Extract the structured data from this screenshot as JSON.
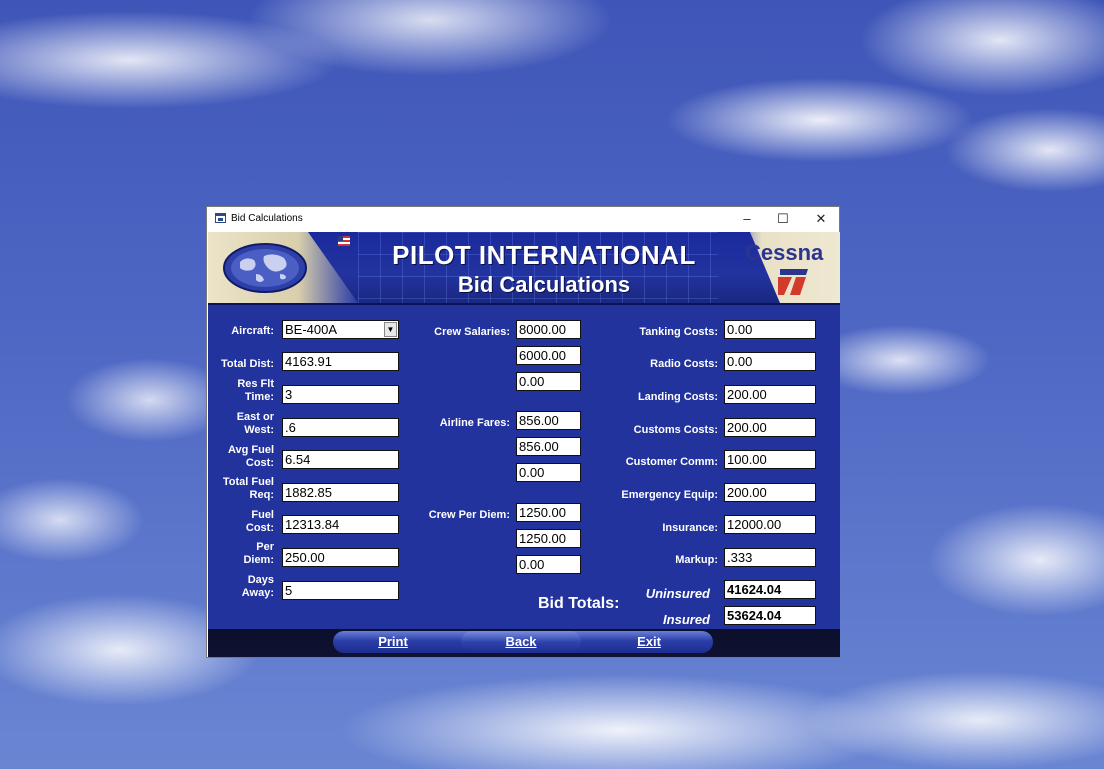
{
  "window": {
    "title": "Bid Calculations"
  },
  "banner": {
    "title": "PILOT INTERNATIONAL",
    "subtitle": "Bid Calculations",
    "brand": "Cessna"
  },
  "left": {
    "aircraft": {
      "label": "Aircraft:",
      "value": "BE-400A"
    },
    "total_dist": {
      "label": "Total Dist:",
      "value": "4163.91"
    },
    "res_flt_time": {
      "label_1": "Res Flt",
      "label_2": "Time:",
      "value": "3"
    },
    "east_west": {
      "label_1": "East or",
      "label_2": "West:",
      "value": ".6"
    },
    "avg_fuel_cost": {
      "label_1": "Avg Fuel",
      "label_2": "Cost:",
      "value": "6.54"
    },
    "total_fuel_req": {
      "label_1": "Total Fuel",
      "label_2": "Req:",
      "value": "1882.85"
    },
    "fuel_cost": {
      "label_1": "Fuel",
      "label_2": "Cost:",
      "value": "12313.84"
    },
    "per_diem": {
      "label_1": "Per",
      "label_2": "Diem:",
      "value": "250.00"
    },
    "days_away": {
      "label_1": "Days",
      "label_2": "Away:",
      "value": "5"
    }
  },
  "middle": {
    "crew_salaries": {
      "label": "Crew Salaries:",
      "values": [
        "8000.00",
        "6000.00",
        "0.00"
      ]
    },
    "airline_fares": {
      "label": "Airline Fares:",
      "values": [
        "856.00",
        "856.00",
        "0.00"
      ]
    },
    "crew_per_diem": {
      "label": "Crew Per Diem:",
      "values": [
        "1250.00",
        "1250.00",
        "0.00"
      ]
    },
    "bid_totals_label": "Bid Totals:"
  },
  "right": {
    "tanking_costs": {
      "label": "Tanking Costs:",
      "value": "0.00"
    },
    "radio_costs": {
      "label": "Radio Costs:",
      "value": "0.00"
    },
    "landing_costs": {
      "label": "Landing Costs:",
      "value": "200.00"
    },
    "customs_costs": {
      "label": "Customs Costs:",
      "value": "200.00"
    },
    "customer_comm": {
      "label": "Customer Comm:",
      "value": "100.00"
    },
    "emergency_equip": {
      "label": "Emergency Equip:",
      "value": "200.00"
    },
    "insurance": {
      "label": "Insurance:",
      "value": "12000.00"
    },
    "markup": {
      "label": "Markup:",
      "value": ".333"
    },
    "uninsured": {
      "label": "Uninsured",
      "value": "41624.04"
    },
    "insured": {
      "label": "Insured",
      "value": "53624.04"
    }
  },
  "footer": {
    "print": "Print",
    "back": "Back",
    "exit": "Exit"
  },
  "colors": {
    "form_bg": "#22339d",
    "banner_bg": "#1a2a9c",
    "footer_bg": "#0c0f2c"
  }
}
